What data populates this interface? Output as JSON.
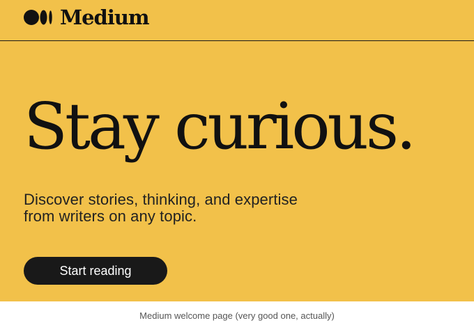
{
  "brand": {
    "name": "Medium",
    "logo_icon": "medium-logo-icon",
    "accent_color": "#f2c14a",
    "text_color": "#111111"
  },
  "hero": {
    "headline": "Stay curious.",
    "subtitle": "Discover stories, thinking, and expertise from writers on any topic.",
    "cta_label": "Start reading"
  },
  "caption": "Medium welcome page (very good one, actually)"
}
